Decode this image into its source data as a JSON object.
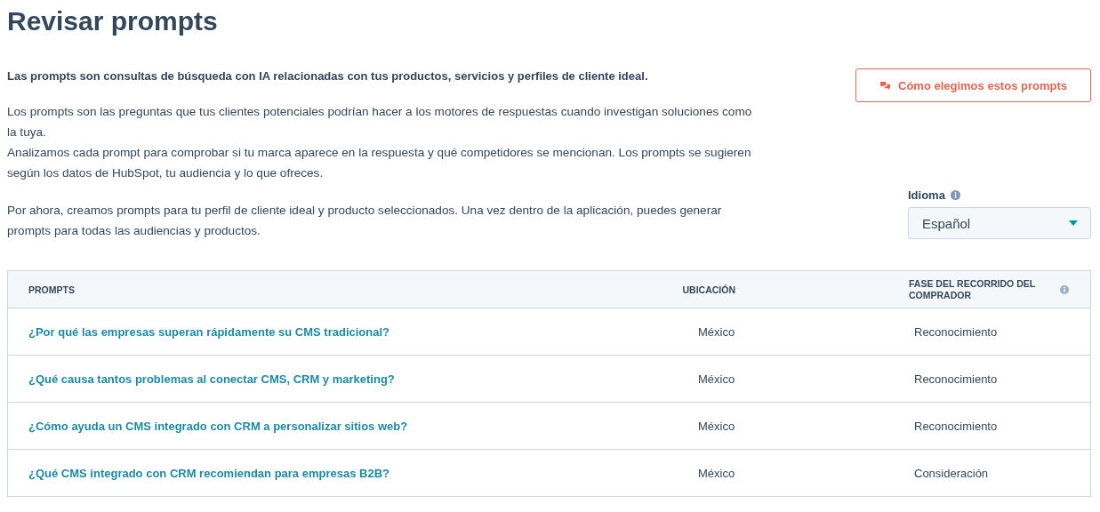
{
  "title": "Revisar prompts",
  "lead": "Las prompts son consultas de búsqueda con IA relacionadas con tus productos, servicios y perfiles de cliente ideal.",
  "paragraphs": [
    "Los prompts son las preguntas que tus clientes potenciales podrían hacer a los motores de respuestas cuando investigan soluciones como la tuya.\nAnalizamos cada prompt para comprobar si tu marca aparece en la respuesta y qué competidores se mencionan. Los prompts se sugieren según los datos de HubSpot, tu audiencia y lo que ofreces.",
    "Por ahora, creamos prompts para tu perfil de cliente ideal y producto seleccionados. Una vez dentro de la aplicación, puedes generar prompts para todas las audiencias y productos."
  ],
  "help_button": {
    "label": "Cómo elegimos estos prompts"
  },
  "language": {
    "label": "Idioma",
    "value": "Español"
  },
  "table": {
    "columns": [
      {
        "label": "PROMPTS",
        "info": false
      },
      {
        "label": "UBICACIÓN",
        "info": false
      },
      {
        "label": "FASE DEL RECORRIDO DEL COMPRADOR",
        "info": true
      }
    ],
    "rows": [
      {
        "prompt": "¿Por qué las empresas superan rápidamente su CMS tradicional?",
        "location": "México",
        "stage": "Reconocimiento"
      },
      {
        "prompt": "¿Qué causa tantos problemas al conectar CMS, CRM y marketing?",
        "location": "México",
        "stage": "Reconocimiento"
      },
      {
        "prompt": "¿Cómo ayuda un CMS integrado con CRM a personalizar sitios web?",
        "location": "México",
        "stage": "Reconocimiento"
      },
      {
        "prompt": "¿Qué CMS integrado con CRM recomiendan para empresas B2B?",
        "location": "México",
        "stage": "Consideración"
      }
    ]
  }
}
